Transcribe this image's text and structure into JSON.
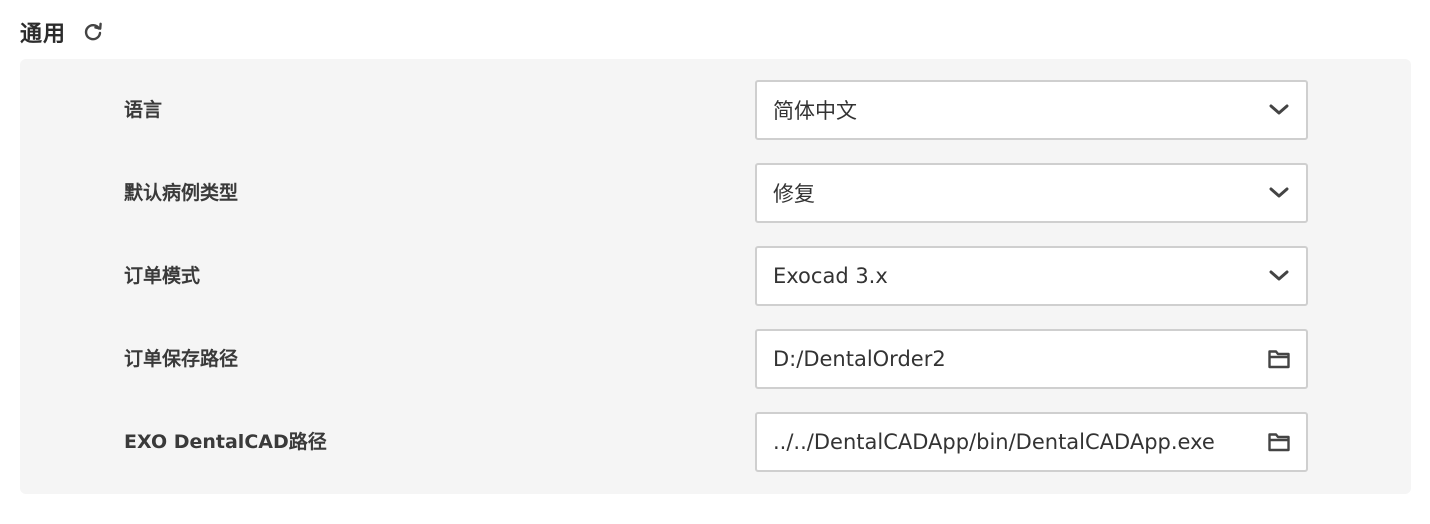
{
  "section": {
    "title": "通用",
    "refresh_icon": "refresh-icon"
  },
  "settings": [
    {
      "label": "语言",
      "value": "简体中文",
      "control": "dropdown",
      "icon": "chevron-down-icon"
    },
    {
      "label": "默认病例类型",
      "value": "修复",
      "control": "dropdown",
      "icon": "chevron-down-icon"
    },
    {
      "label": "订单模式",
      "value": "Exocad 3.x",
      "control": "dropdown",
      "icon": "chevron-down-icon"
    },
    {
      "label": "订单保存路径",
      "value": "D:/DentalOrder2",
      "control": "folder-picker",
      "icon": "folder-icon"
    },
    {
      "label": "EXO DentalCAD路径",
      "value": "../../DentalCADApp/bin/DentalCADApp.exe",
      "control": "folder-picker",
      "icon": "folder-icon"
    }
  ],
  "colors": {
    "panel_background": "#f5f5f5",
    "control_border": "#cfcfcf",
    "text": "#333333"
  }
}
